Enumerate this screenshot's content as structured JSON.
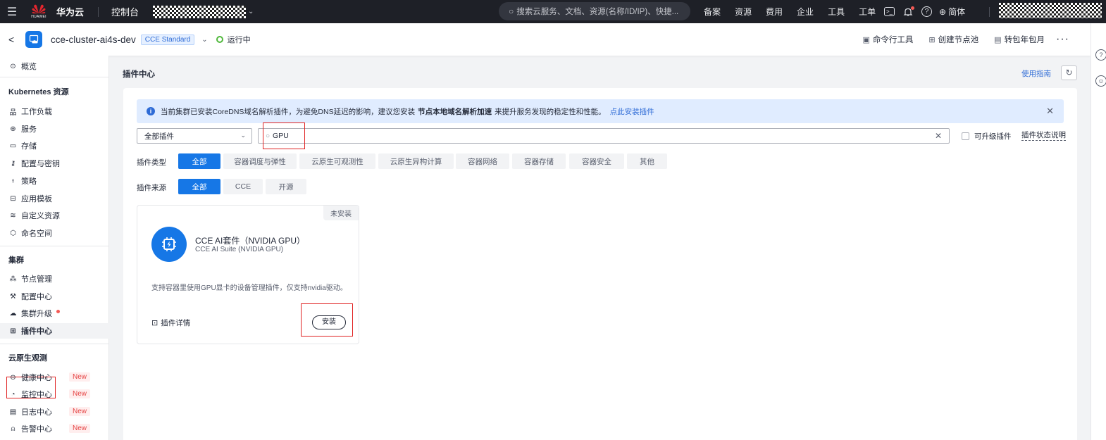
{
  "topbar": {
    "menu_icon": "menu-icon",
    "logo_text": "HUAWEI",
    "brand": "华为云",
    "console": "控制台",
    "search_placeholder": "搜索云服务、文档、资源(名称/ID/IP)、快捷...",
    "nav": [
      "备案",
      "资源",
      "费用",
      "企业",
      "工具",
      "工单"
    ],
    "lang": "简体"
  },
  "subheader": {
    "cluster_name": "cce-cluster-ai4s-dev",
    "cluster_tag": "CCE Standard",
    "status": "运行中",
    "actions": [
      "命令行工具",
      "创建节点池",
      "转包年包月"
    ],
    "status_color": "#50b83c"
  },
  "sidebar": {
    "overview": "概览",
    "k8s_section": "Kubernetes 资源",
    "k8s_items": [
      "工作负载",
      "服务",
      "存储",
      "配置与密钥",
      "策略",
      "应用模板",
      "自定义资源",
      "命名空间"
    ],
    "cluster_section": "集群",
    "cluster_items": [
      "节点管理",
      "配置中心",
      "集群升级",
      "插件中心"
    ],
    "obs_section": "云原生观测",
    "obs_items": [
      "健康中心",
      "监控中心",
      "日志中心",
      "告警中心"
    ],
    "new_badge": "New"
  },
  "main": {
    "title": "插件中心",
    "guide": "使用指南",
    "notice": {
      "prefix": "当前集群已安装CoreDNS域名解析插件，为避免DNS延迟的影响，建议您安装",
      "bold": "节点本地域名解析加速",
      "suffix": "来提升服务发现的稳定性和性能。",
      "link": "点此安装插件"
    },
    "filter": {
      "select_value": "全部插件",
      "search_value": "GPU",
      "upgradable_label": "可升级插件",
      "status_help": "插件状态说明"
    },
    "type_label": "插件类型",
    "types": [
      "全部",
      "容器调度与弹性",
      "云原生可观测性",
      "云原生异构计算",
      "容器网络",
      "容器存储",
      "容器安全",
      "其他"
    ],
    "source_label": "插件来源",
    "sources": [
      "全部",
      "CCE",
      "开源"
    ],
    "plugin": {
      "state": "未安装",
      "name": "CCE AI套件（NVIDIA GPU）",
      "subname": "CCE AI Suite (NVIDIA GPU)",
      "description": "支持容器里使用GPU显卡的设备管理插件，仅支持nvidia驱动。",
      "detail": "插件详情",
      "install": "安装"
    },
    "accent_color": "#1677e6",
    "highlight_color": "#e02222"
  }
}
